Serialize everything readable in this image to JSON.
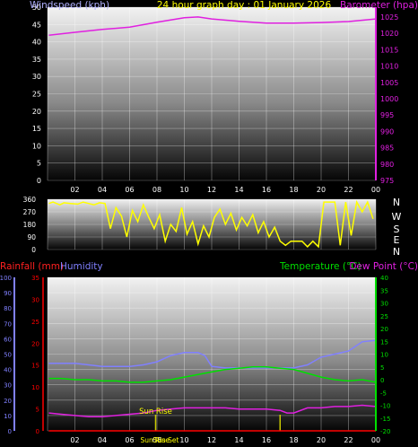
{
  "title": "24 hour graph day : 01 January 2026",
  "chart_data": [
    {
      "type": "line",
      "title": "24 hour graph day : 01 January 2026",
      "y_left_label": "Windspeed (kph)",
      "y_right_label": "Barometer (hpa)",
      "y_left_ticks": [
        "0",
        "5",
        "10",
        "15",
        "20",
        "25",
        "30",
        "35",
        "40",
        "45",
        "50"
      ],
      "y_left_range": [
        0,
        50
      ],
      "y_right_ticks": [
        "975",
        "980",
        "985",
        "990",
        "995",
        "1000",
        "1005",
        "1010",
        "1015",
        "1020",
        "1025"
      ],
      "y_right_range": [
        975,
        1028
      ],
      "x_ticks": [
        "02",
        "04",
        "06",
        "08",
        "10",
        "12",
        "14",
        "16",
        "18",
        "20",
        "22",
        "00"
      ],
      "x_range_hours": [
        0,
        24
      ],
      "grid": true,
      "series": [
        {
          "name": "Barometer (hpa)",
          "color": "#e020e0",
          "axis": "right",
          "x": [
            0.1,
            2,
            4,
            6,
            8,
            10,
            11,
            12,
            14,
            16,
            18,
            20,
            22,
            24
          ],
          "y": [
            1019.4,
            1020.3,
            1021.2,
            1021.9,
            1023.4,
            1024.8,
            1025.0,
            1024.4,
            1023.7,
            1023.1,
            1023.1,
            1023.3,
            1023.6,
            1024.4
          ]
        },
        {
          "name": "Windspeed (kph)",
          "color": "#b0b0ff",
          "axis": "left",
          "x": [],
          "y": []
        }
      ]
    },
    {
      "type": "line",
      "title": "",
      "y_left_ticks": [
        "0",
        "90",
        "180",
        "270",
        "360"
      ],
      "y_left_range": [
        0,
        360
      ],
      "y_right_labels": [
        "N",
        "W",
        "S",
        "E",
        "N"
      ],
      "x_ticks": [
        "02",
        "04",
        "06",
        "08",
        "10",
        "12",
        "14",
        "16",
        "18",
        "20",
        "22",
        "00"
      ],
      "x_range_hours": [
        0,
        24
      ],
      "grid": true,
      "series": [
        {
          "name": "Wind direction",
          "color": "#ffff00",
          "x": [
            0.1,
            0.4,
            0.9,
            1.2,
            1.7,
            2.2,
            2.6,
            3.0,
            3.4,
            3.8,
            4.2,
            4.6,
            5.0,
            5.4,
            5.8,
            6.2,
            6.6,
            7.0,
            7.4,
            7.8,
            8.2,
            8.6,
            9.0,
            9.4,
            9.8,
            10.2,
            10.6,
            11.0,
            11.4,
            11.8,
            12.2,
            12.6,
            13.0,
            13.4,
            13.8,
            14.2,
            14.6,
            15.0,
            15.4,
            15.8,
            16.2,
            16.6,
            17.0,
            17.4,
            17.8,
            18.2,
            18.6,
            19.0,
            19.4,
            19.8,
            20.2,
            20.6,
            21.0,
            21.4,
            21.8,
            22.2,
            22.6,
            23.0,
            23.4,
            23.8
          ],
          "y": [
            330,
            340,
            320,
            335,
            330,
            325,
            340,
            330,
            320,
            335,
            330,
            150,
            300,
            240,
            90,
            280,
            200,
            320,
            230,
            150,
            250,
            60,
            180,
            130,
            300,
            110,
            200,
            40,
            170,
            90,
            230,
            290,
            180,
            260,
            140,
            230,
            170,
            250,
            120,
            200,
            90,
            160,
            60,
            30,
            60,
            60,
            60,
            20,
            60,
            20,
            340,
            340,
            340,
            30,
            340,
            100,
            340,
            270,
            340,
            220
          ]
        }
      ]
    },
    {
      "type": "line",
      "title": "",
      "y_left_outer_label": "Rainfall (mm)",
      "y_left_inner_label": "Humidity",
      "y_right_inner_label": "Temperature (°C)",
      "y_right_outer_label": "Dew Point (°C)",
      "humidity_ticks": [
        "0",
        "10",
        "20",
        "30",
        "40",
        "50",
        "60",
        "70",
        "80",
        "90",
        "100"
      ],
      "humidity_range": [
        0,
        100
      ],
      "rain_ticks": [
        "0",
        "5",
        "10",
        "15",
        "20",
        "25",
        "30",
        "35"
      ],
      "rain_range": [
        0,
        35
      ],
      "temp_ticks": [
        "-20",
        "-15",
        "-10",
        "-5",
        "0",
        "5",
        "10",
        "15",
        "20",
        "25",
        "30",
        "35",
        "40"
      ],
      "temp_range": [
        -20,
        40
      ],
      "x_ticks": [
        "02",
        "04",
        "06",
        "08",
        "10",
        "12",
        "14",
        "16",
        "18",
        "20",
        "22",
        "00"
      ],
      "x_range_hours": [
        0,
        24
      ],
      "annotations": [
        "Sun Rise",
        "Sun Rise",
        "Sun Set"
      ],
      "sunrise_hour": 7.9,
      "sunset_hour": 17.0,
      "grid": true,
      "series": [
        {
          "name": "Humidity",
          "color": "#8080ff",
          "axis": "humidity",
          "x": [
            0.1,
            1,
            2,
            3,
            4,
            5,
            6,
            7,
            8,
            9,
            10,
            11,
            11.5,
            12,
            13,
            14,
            15,
            16,
            17,
            18,
            19,
            20,
            21,
            22,
            23,
            24
          ],
          "y": [
            44,
            44,
            44,
            43,
            42,
            42,
            42,
            43,
            45,
            49,
            51,
            51,
            49,
            42,
            41,
            41,
            41,
            41,
            41,
            41,
            43,
            48,
            50,
            52,
            58,
            59
          ]
        },
        {
          "name": "Temperature (°C)",
          "color": "#00e000",
          "axis": "temp",
          "x": [
            0.1,
            1,
            2,
            3,
            4,
            5,
            6,
            7,
            8,
            9,
            10,
            11,
            12,
            13,
            14,
            15,
            16,
            17,
            18,
            19,
            20,
            21,
            22,
            23,
            24
          ],
          "y": [
            0.5,
            0.5,
            0,
            0,
            -0.5,
            -0.5,
            -1,
            -1,
            -0.5,
            0,
            1,
            2,
            3,
            4,
            4.5,
            5,
            5,
            4.5,
            4,
            2.5,
            1,
            0,
            -0.5,
            0,
            -1
          ]
        },
        {
          "name": "Dew Point (°C)",
          "color": "#e020e0",
          "axis": "temp",
          "x": [
            0.1,
            1,
            2,
            3,
            4,
            5,
            6,
            7,
            8,
            9,
            10,
            11,
            12,
            13,
            14,
            15,
            16,
            17,
            17.5,
            18,
            19,
            20,
            21,
            22,
            23,
            24
          ],
          "y": [
            -13,
            -13.5,
            -14,
            -14.5,
            -14.5,
            -14,
            -13.5,
            -13,
            -12,
            -11.5,
            -11,
            -11,
            -11,
            -11,
            -11.5,
            -11.5,
            -11.5,
            -12,
            -13,
            -13,
            -11,
            -11,
            -10.5,
            -10.5,
            -10,
            -10.5
          ]
        },
        {
          "name": "Rainfall (mm)",
          "color": "#ff0000",
          "axis": "rain",
          "x": [
            0.1,
            24
          ],
          "y": [
            0,
            0
          ]
        }
      ]
    }
  ],
  "colors": {
    "windspeed": "#b0b0ff",
    "barometer": "#e020e0",
    "title": "#ffff00",
    "wind_direction": "#ffff00",
    "rainfall": "#ff0000",
    "humidity": "#8080ff",
    "temperature": "#00e000",
    "dew_point": "#e020e0",
    "sun_marker": "#c8c800",
    "compass_text": "#ffffff",
    "annotation": "#ffff00"
  }
}
